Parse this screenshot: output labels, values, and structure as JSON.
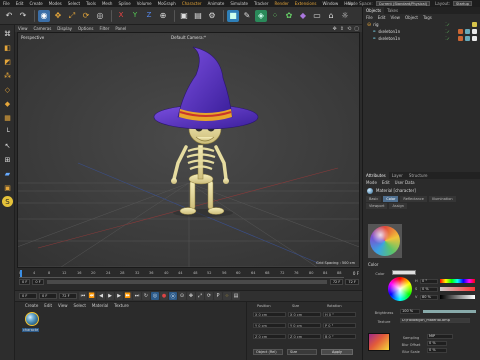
{
  "menubar": {
    "items": [
      "File",
      "Edit",
      "Create",
      "Modes",
      "Select",
      "Tools",
      "Mesh",
      "Spline",
      "Volume",
      "MoGraph",
      "Character",
      "Animate",
      "Simulate",
      "Tracker",
      "Render",
      "Extensions",
      "Window",
      "Help"
    ],
    "node_space_label": "Node Space:",
    "node_space_value": "Current (Standard/Physical)",
    "layout_label": "Layout:",
    "layout_value": "Startup"
  },
  "toolbar": {
    "icons": [
      "undo-icon",
      "redo-icon",
      "live-selection-icon",
      "move-icon",
      "scale-icon",
      "rotate-icon",
      "recent-tools-icon",
      "x-axis-icon",
      "y-axis-icon",
      "z-axis-icon",
      "world-coords-icon",
      "render-view-icon",
      "render-picture-queue-icon",
      "render-settings-icon",
      "cube-icon",
      "pen-icon",
      "subdivision-icon",
      "array-icon",
      "mograph-icon",
      "deformer-icon",
      "floor-icon",
      "camera-icon",
      "light-icon"
    ]
  },
  "leftbar": {
    "icons": [
      "make-editable-icon",
      "model-mode-icon",
      "texture-mode-icon",
      "points-mode-icon",
      "edges-mode-icon",
      "polygons-mode-icon",
      "uv-mode-icon",
      "enable-axis-icon",
      "tweak-icon",
      "snapping-icon",
      "workplane-icon",
      "locked-workplane-icon",
      "solo-icon"
    ]
  },
  "viewport": {
    "menu": [
      "View",
      "Cameras",
      "Display",
      "Options",
      "Filter",
      "Panel"
    ],
    "label": "Perspective",
    "camera": "Default Camera:*",
    "grid_spacing": "Grid Spacing : 500 cm"
  },
  "timeline": {
    "ticks": [
      "0",
      "4",
      "8",
      "12",
      "16",
      "20",
      "24",
      "28",
      "32",
      "36",
      "40",
      "44",
      "48",
      "52",
      "56",
      "60",
      "64",
      "68",
      "72",
      "76",
      "80",
      "84",
      "88"
    ],
    "current_frame": "0 F",
    "start_field": "0 F",
    "start_field_2": "0 F",
    "end_field": "72 F",
    "end_field_2": "72 F"
  },
  "transport": {
    "current_field": "0 F",
    "min_field": "0 F",
    "max_field": "72 F"
  },
  "material_manager": {
    "menu": [
      "Create",
      "Edit",
      "View",
      "Select",
      "Material",
      "Texture"
    ],
    "material_name": "characte"
  },
  "coords": {
    "headers": [
      "Position",
      "Size",
      "Rotation"
    ],
    "rows": [
      [
        "X",
        "0 cm",
        "X",
        "0 cm",
        "H",
        "0 °"
      ],
      [
        "Y",
        "0 cm",
        "Y",
        "0 cm",
        "P",
        "0 °"
      ],
      [
        "Z",
        "0 cm",
        "Z",
        "0 cm",
        "B",
        "0 °"
      ]
    ],
    "mode_select": "Object (Rel)",
    "size_select": "Size",
    "apply_label": "Apply"
  },
  "object_manager": {
    "tabs": [
      "Objects",
      "Takes"
    ],
    "menu": [
      "File",
      "Edit",
      "View",
      "Object",
      "Tags"
    ],
    "objects": [
      {
        "name": "rig",
        "icon": "null-icon"
      },
      {
        "name": "skeleton1n",
        "icon": "joint-icon"
      },
      {
        "name": "skeleton1n",
        "icon": "joint-icon"
      }
    ]
  },
  "attributes": {
    "tabs": [
      "Attributes",
      "Layer",
      "Structure"
    ],
    "menu": [
      "Mode",
      "Edit",
      "User Data"
    ],
    "title": "Material [character]",
    "section_tabs": [
      "Basic",
      "Color",
      "Reflectance",
      "Illumination",
      "Viewport",
      "Assign"
    ],
    "active_tab": "Color",
    "color_section": "Color",
    "color_label": "Color",
    "h_label": "H",
    "h_value": "0 °",
    "s_label": "S",
    "s_value": "0 %",
    "v_label": "V",
    "v_value": "80 %",
    "brightness_label": "Brightness",
    "brightness_value": "100 %",
    "brightness_fraction": 1.0,
    "texture_label": "Texture",
    "texture_value": "D:\\Follow\\Jon_material.bmp",
    "sampling_label": "Sampling",
    "sampling_value": "MIP",
    "blur_offset_label": "Blur Offset",
    "blur_offset_value": "0 %",
    "blur_scale_label": "Blur Scale",
    "blur_scale_value": "0 %"
  }
}
